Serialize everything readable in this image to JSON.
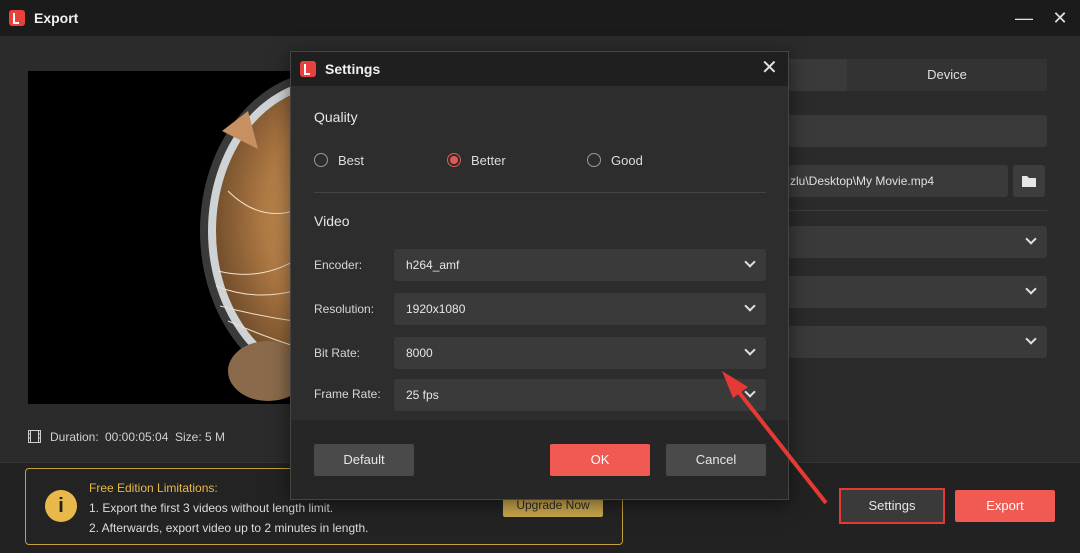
{
  "window": {
    "title": "Export",
    "minimize_glyph": "—",
    "close_glyph": "✕"
  },
  "preview": {
    "duration_label": "Duration:",
    "duration_value": "00:00:05:04",
    "size_label": "Size:",
    "size_value": "5 M"
  },
  "right_panel": {
    "tab_device": "Device",
    "path_text": "zlu\\Desktop\\My Movie.mp4"
  },
  "limits": {
    "title": "Free Edition Limitations:",
    "line1": "1. Export the first 3 videos without length limit.",
    "line2": "2. Afterwards, export video up to 2 minutes in length.",
    "upgrade_label": "Upgrade Now"
  },
  "bottom_buttons": {
    "settings_label": "Settings",
    "export_label": "Export"
  },
  "dialog": {
    "title": "Settings",
    "close_glyph": "✕",
    "quality": {
      "title": "Quality",
      "options": [
        {
          "label": "Best",
          "selected": false
        },
        {
          "label": "Better",
          "selected": true
        },
        {
          "label": "Good",
          "selected": false
        }
      ]
    },
    "video": {
      "title": "Video",
      "encoder_label": "Encoder:",
      "encoder_value": "h264_amf",
      "resolution_label": "Resolution:",
      "resolution_value": "1920x1080",
      "bitrate_label": "Bit Rate:",
      "bitrate_value": "8000",
      "framerate_label": "Frame Rate:",
      "framerate_value": "25 fps"
    },
    "buttons": {
      "default_label": "Default",
      "ok_label": "OK",
      "cancel_label": "Cancel"
    }
  },
  "colors": {
    "accent": "#f05a52",
    "highlight_border": "#e53935",
    "warning": "#e8b84a"
  },
  "icons": {
    "app": "app-logo-icon",
    "info": "info-icon",
    "folder": "folder-icon",
    "film": "film-icon"
  }
}
